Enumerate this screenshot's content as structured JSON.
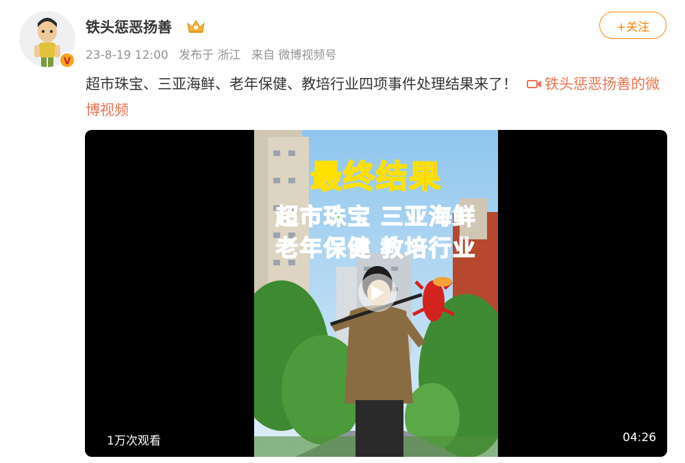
{
  "post": {
    "username": "铁头惩恶扬善",
    "date": "23-8-19 12:00",
    "posted_in": "发布于 浙江",
    "source": "来自 微博视频号",
    "follow_label": "+关注",
    "text": "超市珠宝、三亚海鲜、老年保健、教培行业四项事件处理结果来了！",
    "video_link_label": "铁头惩恶扬善的微博视频"
  },
  "video": {
    "overlay_title": "最终结果",
    "tags": [
      "超市珠宝",
      "三亚海鲜",
      "老年保健",
      "教培行业"
    ],
    "views": "1万次观看",
    "duration": "04:26"
  },
  "colors": {
    "accent": "#ff8200",
    "link": "#eb7350",
    "meta_text": "#939393",
    "username": "#333333"
  },
  "icons": [
    "avatar-cartoon-character",
    "verified-badge-icon",
    "crown-icon",
    "video-camera-icon",
    "play-icon"
  ]
}
